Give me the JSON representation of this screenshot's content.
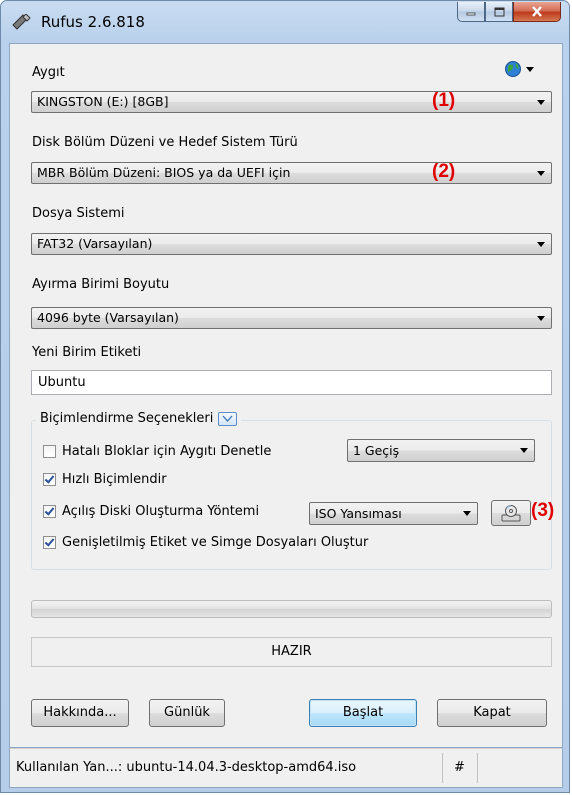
{
  "window": {
    "title": "Rufus 2.6.818",
    "controls": [
      "minimize",
      "maximize",
      "close"
    ]
  },
  "device": {
    "label": "Aygıt",
    "value": "KINGSTON (E:) [8GB]",
    "annotation": "(1)",
    "language_icon": "globe-icon"
  },
  "partition": {
    "label": "Disk Bölüm Düzeni ve Hedef Sistem Türü",
    "value": "MBR Bölüm Düzeni: BIOS ya da UEFI için",
    "annotation": "(2)"
  },
  "filesystem": {
    "label": "Dosya Sistemi",
    "value": "FAT32 (Varsayılan)"
  },
  "cluster": {
    "label": "Ayırma Birimi Boyutu",
    "value": "4096 byte (Varsayılan)"
  },
  "volume": {
    "label": "Yeni Birim Etiketi",
    "value": "Ubuntu"
  },
  "format_options": {
    "title": "Biçimlendirme Seçenekleri",
    "bad_blocks": {
      "label": "Hatalı Bloklar için Aygıtı Denetle",
      "checked": false,
      "passes": "1 Geçiş"
    },
    "quick_format": {
      "label": "Hızlı Biçimlendir",
      "checked": true
    },
    "bootable": {
      "label": "Açılış Diski Oluşturma Yöntemi",
      "checked": true,
      "method": "ISO Yansıması",
      "annotation": "(3)"
    },
    "extended_label": {
      "label": "Genişletilmiş Etiket ve Simge Dosyaları Oluştur",
      "checked": true
    }
  },
  "progress": {
    "value": 0
  },
  "status": {
    "text": "HAZIR"
  },
  "buttons": {
    "about": "Hakkında...",
    "log": "Günlük",
    "start": "Başlat",
    "close": "Kapat"
  },
  "statusbar": {
    "image": "Kullanılan Yan...: ubuntu-14.04.3-desktop-amd64.iso",
    "hash": "#"
  },
  "colors": {
    "annotation": "#e00000",
    "accent": "#3c7fb1"
  }
}
